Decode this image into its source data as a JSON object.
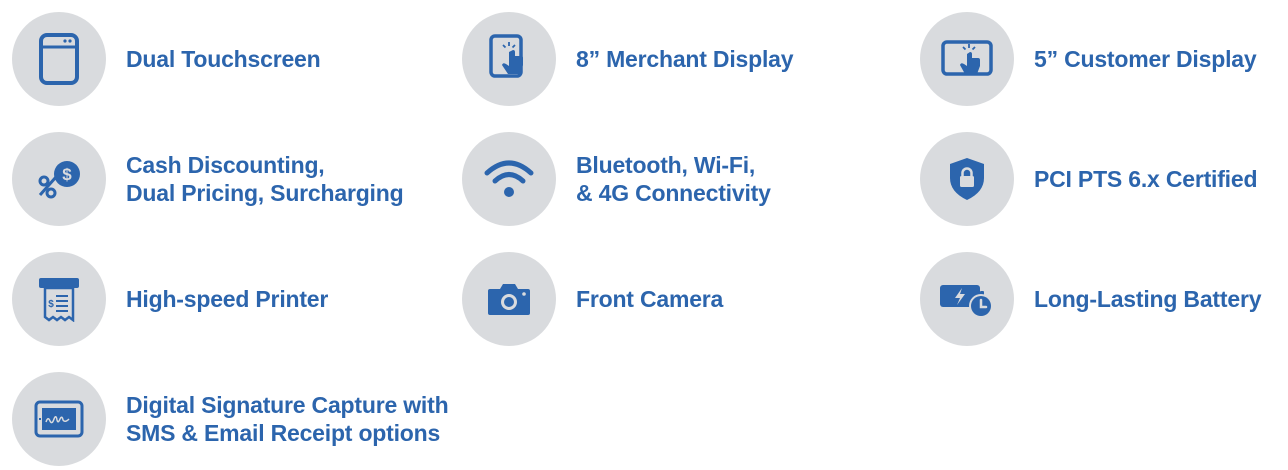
{
  "colors": {
    "icon_blue": "#2c65ad",
    "circle_gray": "#d9dbde",
    "text_blue": "#2c65ad"
  },
  "features": [
    {
      "icon": "dual-touchscreen-icon",
      "lines": [
        "Dual Touchscreen"
      ]
    },
    {
      "icon": "merchant-display-touch-icon",
      "lines": [
        "8” Merchant Display"
      ]
    },
    {
      "icon": "customer-display-touch-icon",
      "lines": [
        "5” Customer Display"
      ]
    },
    {
      "icon": "percent-dollar-icon",
      "lines": [
        "Cash Discounting,",
        "Dual Pricing, Surcharging"
      ]
    },
    {
      "icon": "wifi-icon",
      "lines": [
        "Bluetooth, Wi-Fi,",
        "& 4G Connectivity"
      ]
    },
    {
      "icon": "shield-lock-icon",
      "lines": [
        "PCI PTS 6.x Certified"
      ]
    },
    {
      "icon": "printer-receipt-icon",
      "lines": [
        "High-speed Printer"
      ]
    },
    {
      "icon": "camera-icon",
      "lines": [
        "Front Camera"
      ]
    },
    {
      "icon": "battery-clock-icon",
      "lines": [
        "Long-Lasting Battery"
      ]
    },
    {
      "icon": "signature-tablet-icon",
      "lines": [
        "Digital Signature Capture with",
        "SMS & Email Receipt options"
      ]
    }
  ]
}
